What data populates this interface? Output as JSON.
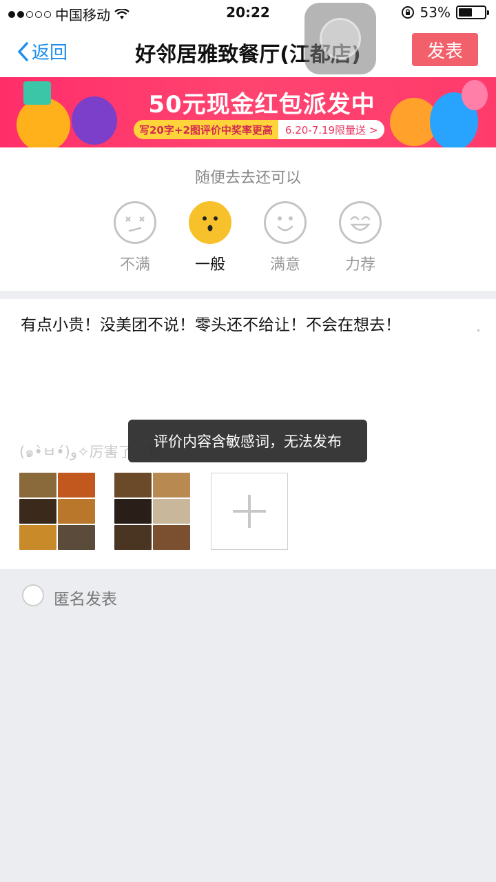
{
  "status_bar": {
    "carrier": "中国移动",
    "time": "20:22",
    "battery": "53%",
    "battery_level": 0.53
  },
  "nav": {
    "back_label": "返回",
    "title": "好邻居雅致餐厅(江都店)",
    "publish_label": "发表"
  },
  "banner": {
    "title": "50元现金红包派发中",
    "subtitle_left": "写20字+2图评价中奖率更高",
    "subtitle_right": "6.20-7.19限量送 >"
  },
  "rating": {
    "prompt": "随便去去还可以",
    "options": [
      {
        "label": "不满",
        "icon": "dissatisfied-face-icon"
      },
      {
        "label": "一般",
        "icon": "average-face-icon",
        "selected": true
      },
      {
        "label": "满意",
        "icon": "satisfied-face-icon"
      },
      {
        "label": "力荐",
        "icon": "recommend-face-icon"
      }
    ]
  },
  "review": {
    "text": "有点小贵！没美团不说！零头还不给让！不会在想去！",
    "hint": "(๑•̀ㅂ•́)و✧厉害了，写"
  },
  "anonymous": {
    "label": "匿名发表"
  },
  "toast": {
    "message": "评价内容含敏感词，无法发布"
  },
  "colors": {
    "accent_blue": "#1d8ef0",
    "publish_red": "#f2616b",
    "selected_face": "#f7c12c"
  }
}
